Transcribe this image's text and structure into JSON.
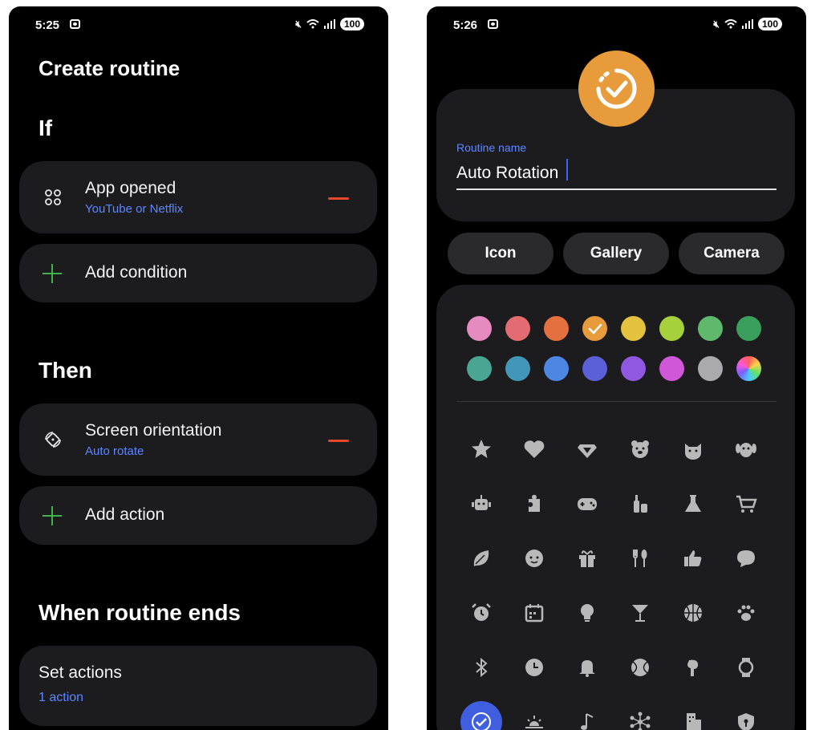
{
  "left": {
    "status": {
      "time": "5:25",
      "battery": "100"
    },
    "title": "Create routine",
    "if_heading": "If",
    "condition": {
      "title": "App opened",
      "subtitle": "YouTube or Netflix"
    },
    "add_condition": "Add condition",
    "then_heading": "Then",
    "action": {
      "title": "Screen orientation",
      "subtitle": "Auto rotate"
    },
    "add_action": "Add action",
    "ends_heading": "When routine ends",
    "set_actions": {
      "title": "Set actions",
      "subtitle": "1 action"
    }
  },
  "right": {
    "status": {
      "time": "5:26",
      "battery": "100"
    },
    "routine_name_label": "Routine name",
    "routine_name_value": "Auto Rotation",
    "buttons": {
      "icon": "Icon",
      "gallery": "Gallery",
      "camera": "Camera"
    },
    "selected_color": "#e79b3b",
    "colors": [
      "#e58bbf",
      "#e36b72",
      "#e3703e",
      "#e79b3b",
      "#e3c23d",
      "#a6d13d",
      "#5fb86b",
      "#3a9f5d",
      "#4aa593",
      "#4296b8",
      "#4e86e3",
      "#5b5fd8",
      "#9058e0",
      "#d157d9",
      "#a9a9ae",
      "gradient"
    ],
    "icons": [
      "star-icon",
      "heart-icon",
      "diamond-icon",
      "bear-icon",
      "cat-icon",
      "dog-icon",
      "robot-icon",
      "puzzle-icon",
      "gamepad-icon",
      "bottles-icon",
      "flask-icon",
      "cart-icon",
      "leaf-icon",
      "baby-icon",
      "gift-icon",
      "utensils-icon",
      "thumbs-up-icon",
      "chat-bubble-icon",
      "alarm-clock-icon",
      "calendar-icon",
      "lightbulb-icon",
      "cocktail-icon",
      "basketball-icon",
      "paw-icon",
      "bluetooth-icon",
      "clock-icon",
      "bell-icon",
      "tennis-ball-icon",
      "earbud-icon",
      "watch-icon",
      "check-circle-icon",
      "sunrise-icon",
      "music-note-icon",
      "network-icon",
      "building-icon",
      "shield-icon"
    ]
  }
}
